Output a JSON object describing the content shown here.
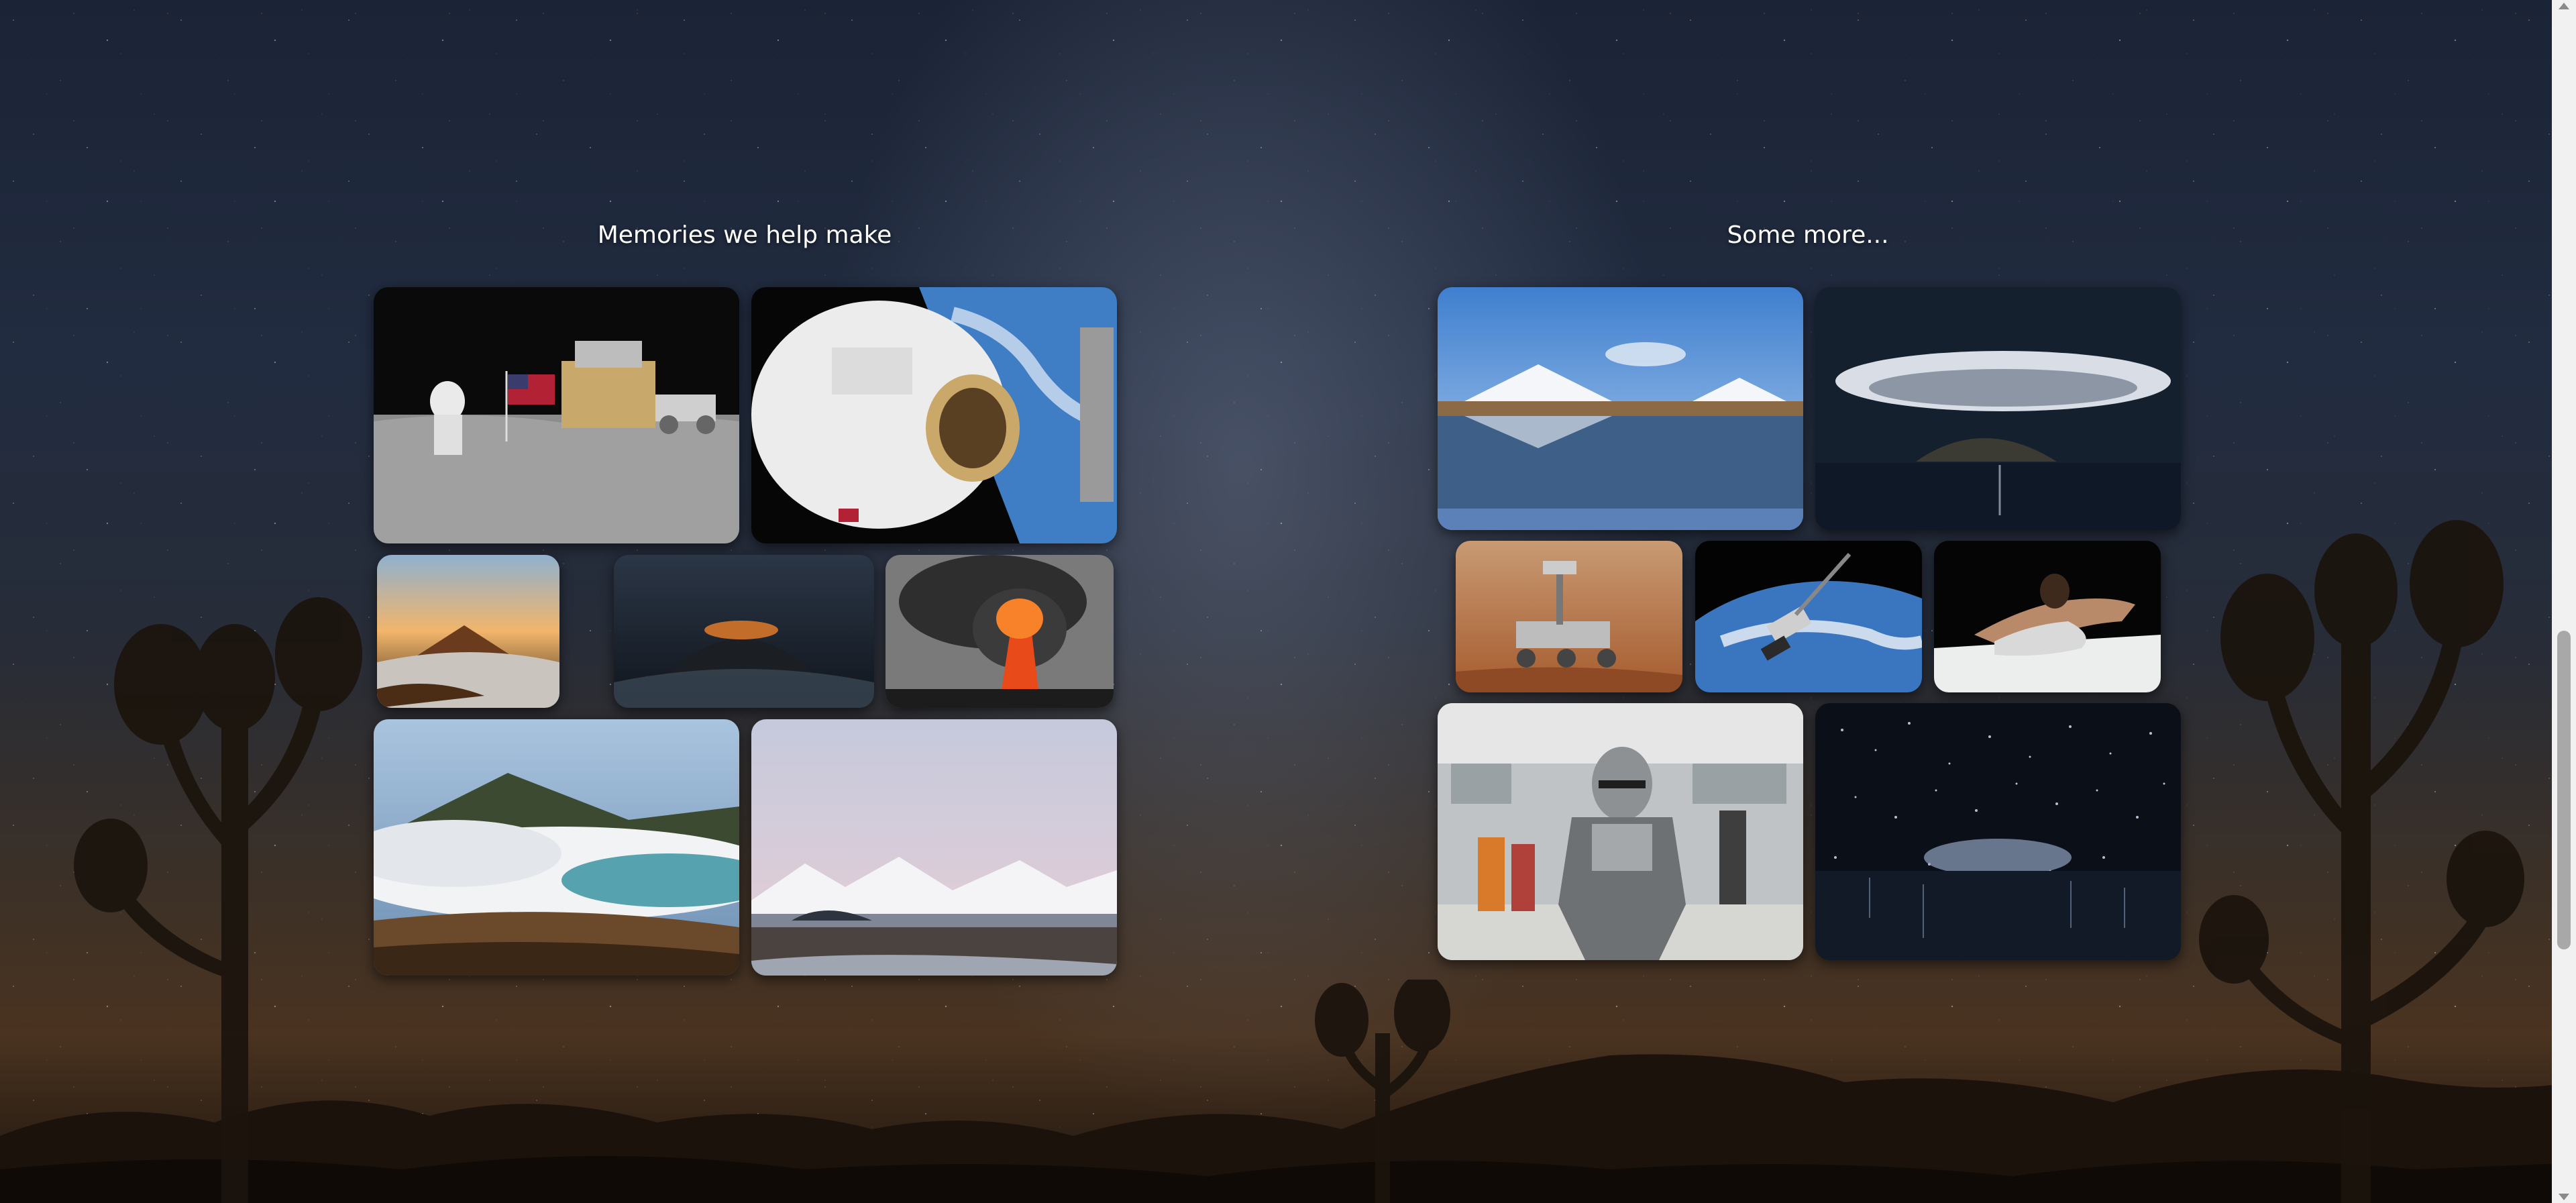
{
  "sections": {
    "memories_title": "Memories we help make",
    "more_title": "Some more..."
  },
  "gallery_left": [
    {
      "name": "photo-moon-landing",
      "subject": "Astronaut with flag on the moon"
    },
    {
      "name": "photo-astronaut-spacewalk",
      "subject": "Astronaut on a spacewalk above Earth"
    },
    {
      "name": "photo-volcano-sunrise",
      "subject": "Volcano crater at sunrise"
    },
    {
      "name": "photo-volcano-night",
      "subject": "Glowing volcano at night"
    },
    {
      "name": "photo-volcano-eruption",
      "subject": "Volcano eruption with lava"
    },
    {
      "name": "photo-volcano-clouds",
      "subject": "Volcano above clouds"
    },
    {
      "name": "photo-snowy-mountains",
      "subject": "Snowy mountains at dusk"
    }
  ],
  "gallery_right": [
    {
      "name": "photo-volcano-lake",
      "subject": "Volcano reflected in lake"
    },
    {
      "name": "photo-storm-island",
      "subject": "Storm cloud over island"
    },
    {
      "name": "photo-mars-rover",
      "subject": "Rover on Mars"
    },
    {
      "name": "photo-spacecraft-earth",
      "subject": "Spacecraft above Earth"
    },
    {
      "name": "photo-dancer",
      "subject": "Person reaching across floor"
    },
    {
      "name": "photo-armored-figure",
      "subject": "Armored costume at convention"
    },
    {
      "name": "photo-light-installation",
      "subject": "Infinity light installation"
    }
  ]
}
